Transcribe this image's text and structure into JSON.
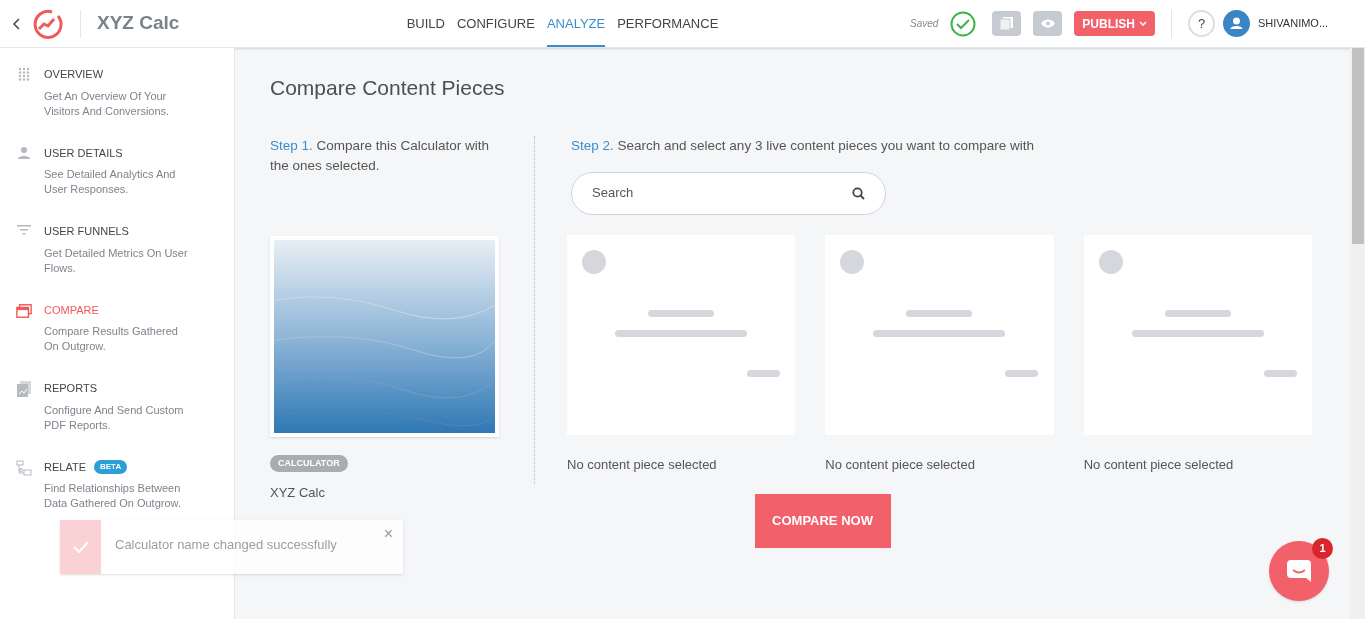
{
  "header": {
    "title": "XYZ Calc",
    "tabs": [
      {
        "label": "BUILD",
        "selected": false
      },
      {
        "label": "CONFIGURE",
        "selected": false
      },
      {
        "label": "ANALYZE",
        "selected": true
      },
      {
        "label": "PERFORMANCE",
        "selected": false
      }
    ],
    "saved": "Saved",
    "publish": "PUBLISH",
    "help": "?",
    "user": "SHIVANIMO..."
  },
  "sidebar": {
    "items": [
      {
        "kind": "grid",
        "title": "OVERVIEW",
        "description": "Get An Overview Of Your Visitors And Conversions.",
        "selected": false
      },
      {
        "kind": "user",
        "title": "USER DETAILS",
        "description": "See Detailed Analytics And User Responses.",
        "selected": false
      },
      {
        "kind": "funnel",
        "title": "USER FUNNELS",
        "description": "Get Detailed Metrics On User Flows.",
        "selected": false
      },
      {
        "kind": "windows",
        "title": "COMPARE",
        "description": "Compare Results Gathered On Outgrow.",
        "selected": true
      },
      {
        "kind": "report",
        "title": "REPORTS",
        "description": "Configure And Send Custom PDF Reports.",
        "selected": false
      },
      {
        "kind": "relate",
        "title": "RELATE",
        "badge": "BETA",
        "description": "Find Relationships Between Data Gathered On Outgrow.",
        "selected": false
      }
    ]
  },
  "main": {
    "heading": "Compare Content Pieces",
    "step1": {
      "label": "Step 1.",
      "text": "Compare this Calculator with the ones selected.",
      "tag": "CALCULATOR",
      "name": "XYZ Calc"
    },
    "step2": {
      "label": "Step 2.",
      "text": "Search and select any 3 live content pieces you want to compare with",
      "search": {
        "placeholder": "Search"
      },
      "slots": [
        {
          "caption": "No content piece selected"
        },
        {
          "caption": "No content piece selected"
        },
        {
          "caption": "No content piece selected"
        }
      ]
    },
    "compare_button": "COMPARE NOW"
  },
  "toast": {
    "message": "Calculator name changed successfully",
    "close": "×"
  },
  "chat": {
    "badge": "1"
  }
}
